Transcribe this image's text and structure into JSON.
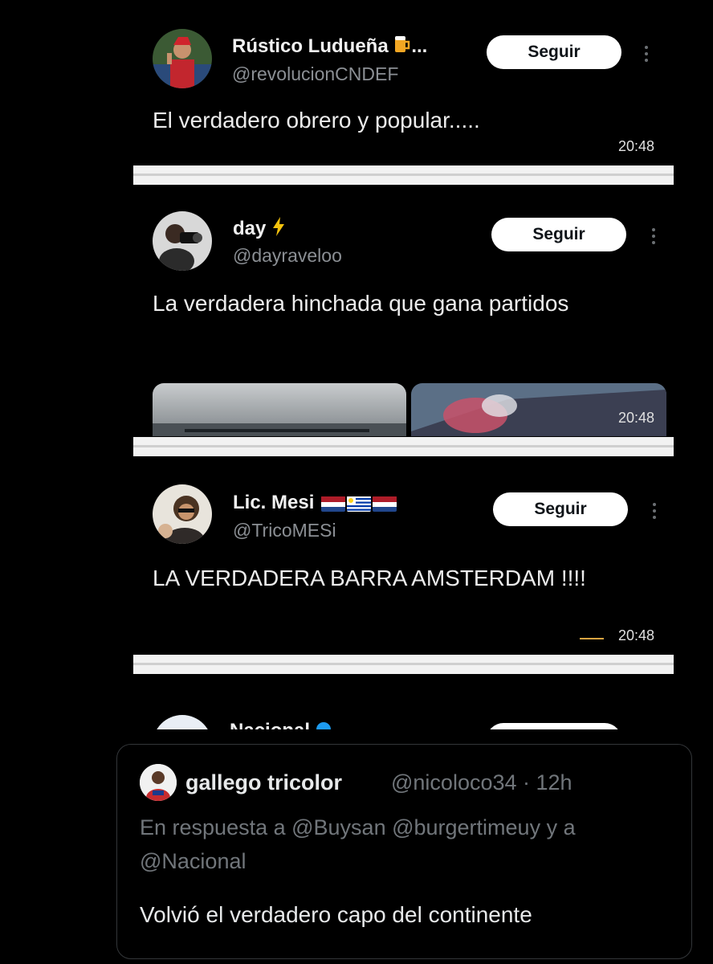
{
  "tweets": [
    {
      "name": "Rústico Ludueña",
      "name_suffix": "...",
      "handle": "@revolucionCNDEF",
      "follow_label": "Seguir",
      "text": "El verdadero obrero y popular.....",
      "time": "20:48"
    },
    {
      "name": "day",
      "handle": "@dayraveloo",
      "follow_label": "Seguir",
      "text": "La verdadera hinchada que gana partidos",
      "time": "20:48"
    },
    {
      "name": "Lic. Mesi",
      "handle": "@TricoMESi",
      "follow_label": "Seguir",
      "text": "LA VERDADERA BARRA AMSTERDAM !!!!",
      "time": "20:48"
    },
    {
      "name": "Nacional"
    }
  ],
  "quote": {
    "name": "gallego tricolor",
    "handle_time": "@nicoloco34 · 12h",
    "reply_context": "En respuesta a @Buysan @burgertimeuy y a @Nacional",
    "text": "Volvió el verdadero capo del continente"
  },
  "colors": {
    "background": "#000000",
    "follow_button": "#ffffff",
    "muted_text": "#71767b",
    "verified": "#1d9bf0"
  }
}
